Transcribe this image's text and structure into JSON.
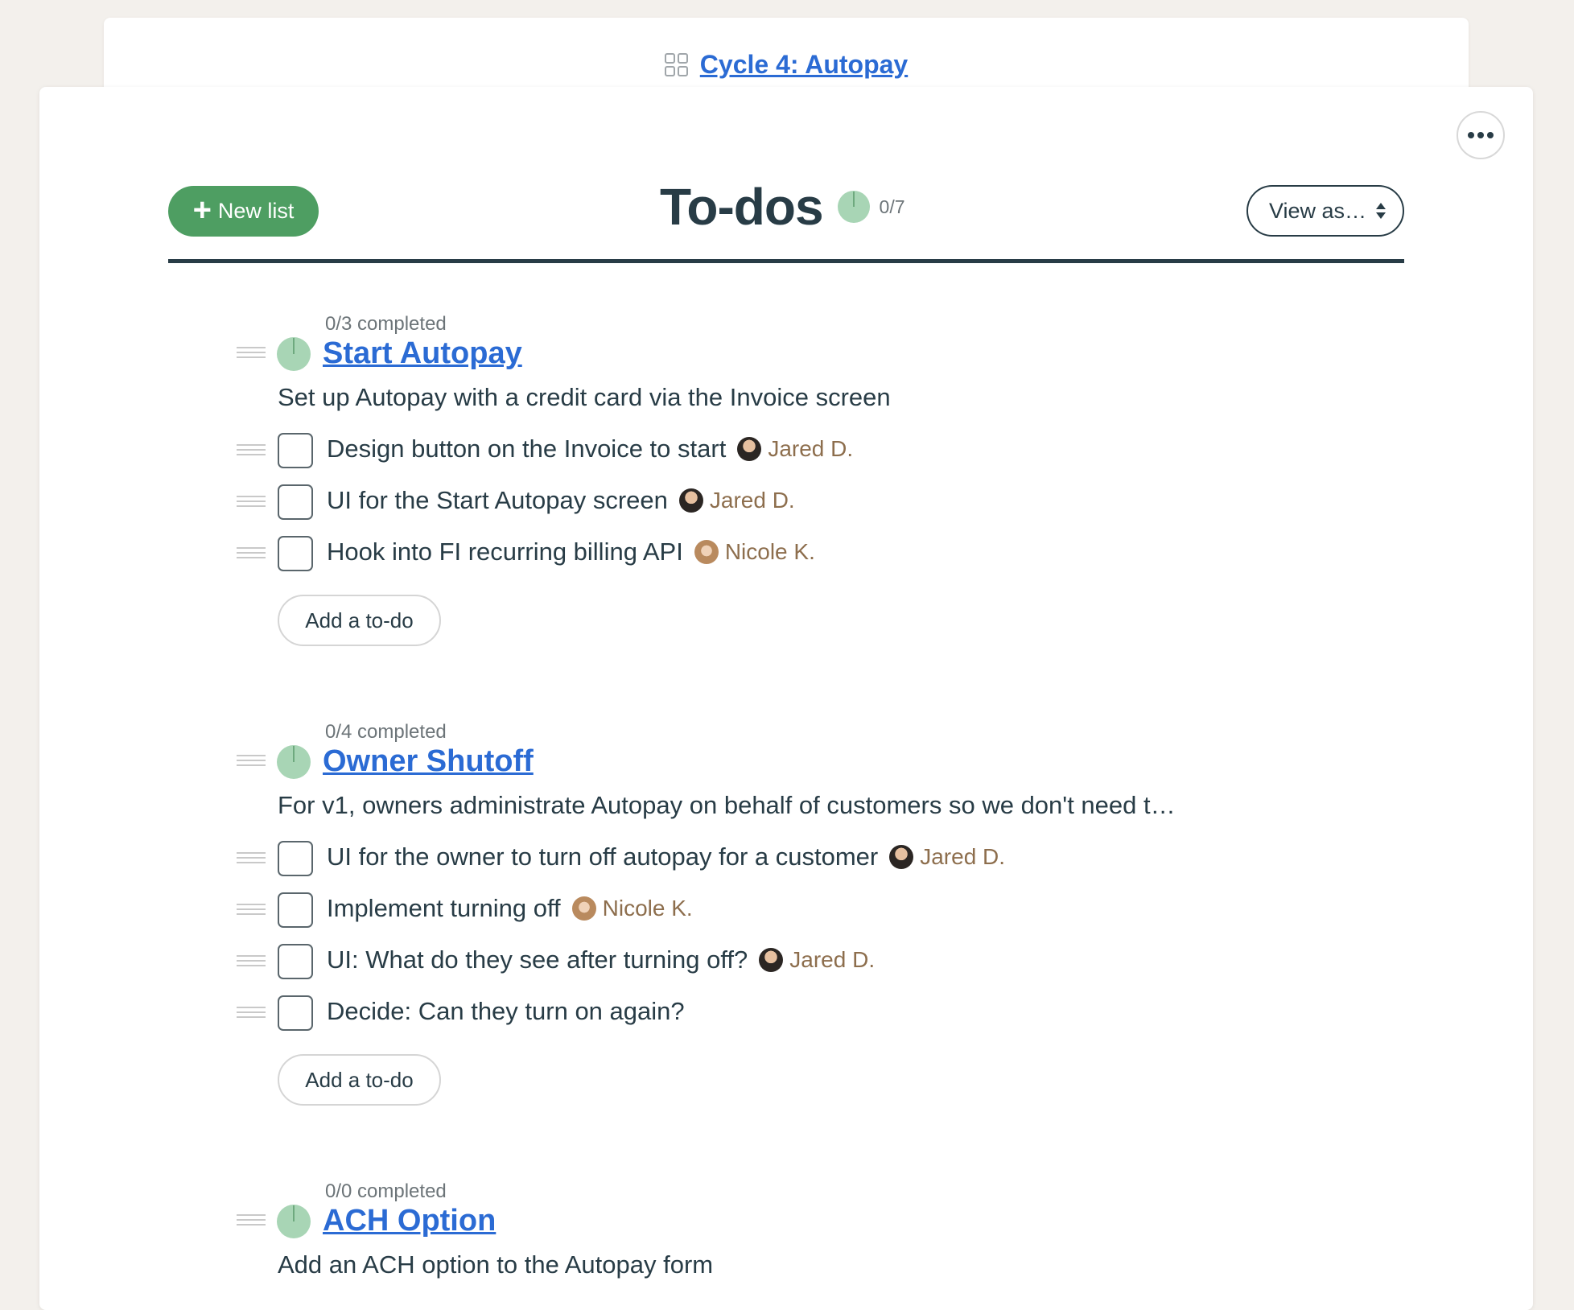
{
  "breadcrumb": {
    "label": "Cycle 4: Autopay"
  },
  "header": {
    "new_list_label": "New list",
    "title": "To-dos",
    "progress": "0/7",
    "view_as_label": "View as…"
  },
  "colors": {
    "accent": "#4e9e62",
    "link": "#2b6bd4",
    "pie": "#a8d5b5",
    "text": "#283c46"
  },
  "lists": [
    {
      "completed": "0/3 completed",
      "title": "Start Autopay",
      "description": "Set up Autopay with a credit card via the Invoice screen",
      "todos": [
        {
          "text": "Design button on the Invoice to start",
          "assignee": "Jared D."
        },
        {
          "text": "UI for the Start Autopay screen",
          "assignee": "Jared D."
        },
        {
          "text": "Hook into FI recurring billing API",
          "assignee": "Nicole K."
        }
      ],
      "add_label": "Add a to-do"
    },
    {
      "completed": "0/4 completed",
      "title": "Owner Shutoff",
      "description": "For v1, owners administrate Autopay on behalf of customers so we don't need t…",
      "todos": [
        {
          "text": "UI for the owner to turn off autopay for a customer",
          "assignee": "Jared D."
        },
        {
          "text": "Implement turning off",
          "assignee": "Nicole K."
        },
        {
          "text": "UI: What do they see after turning off?",
          "assignee": "Jared D."
        },
        {
          "text": "Decide: Can they turn on again?",
          "assignee": ""
        }
      ],
      "add_label": "Add a to-do"
    },
    {
      "completed": "0/0 completed",
      "title": "ACH Option",
      "description": "Add an ACH option to the Autopay form"
    }
  ]
}
